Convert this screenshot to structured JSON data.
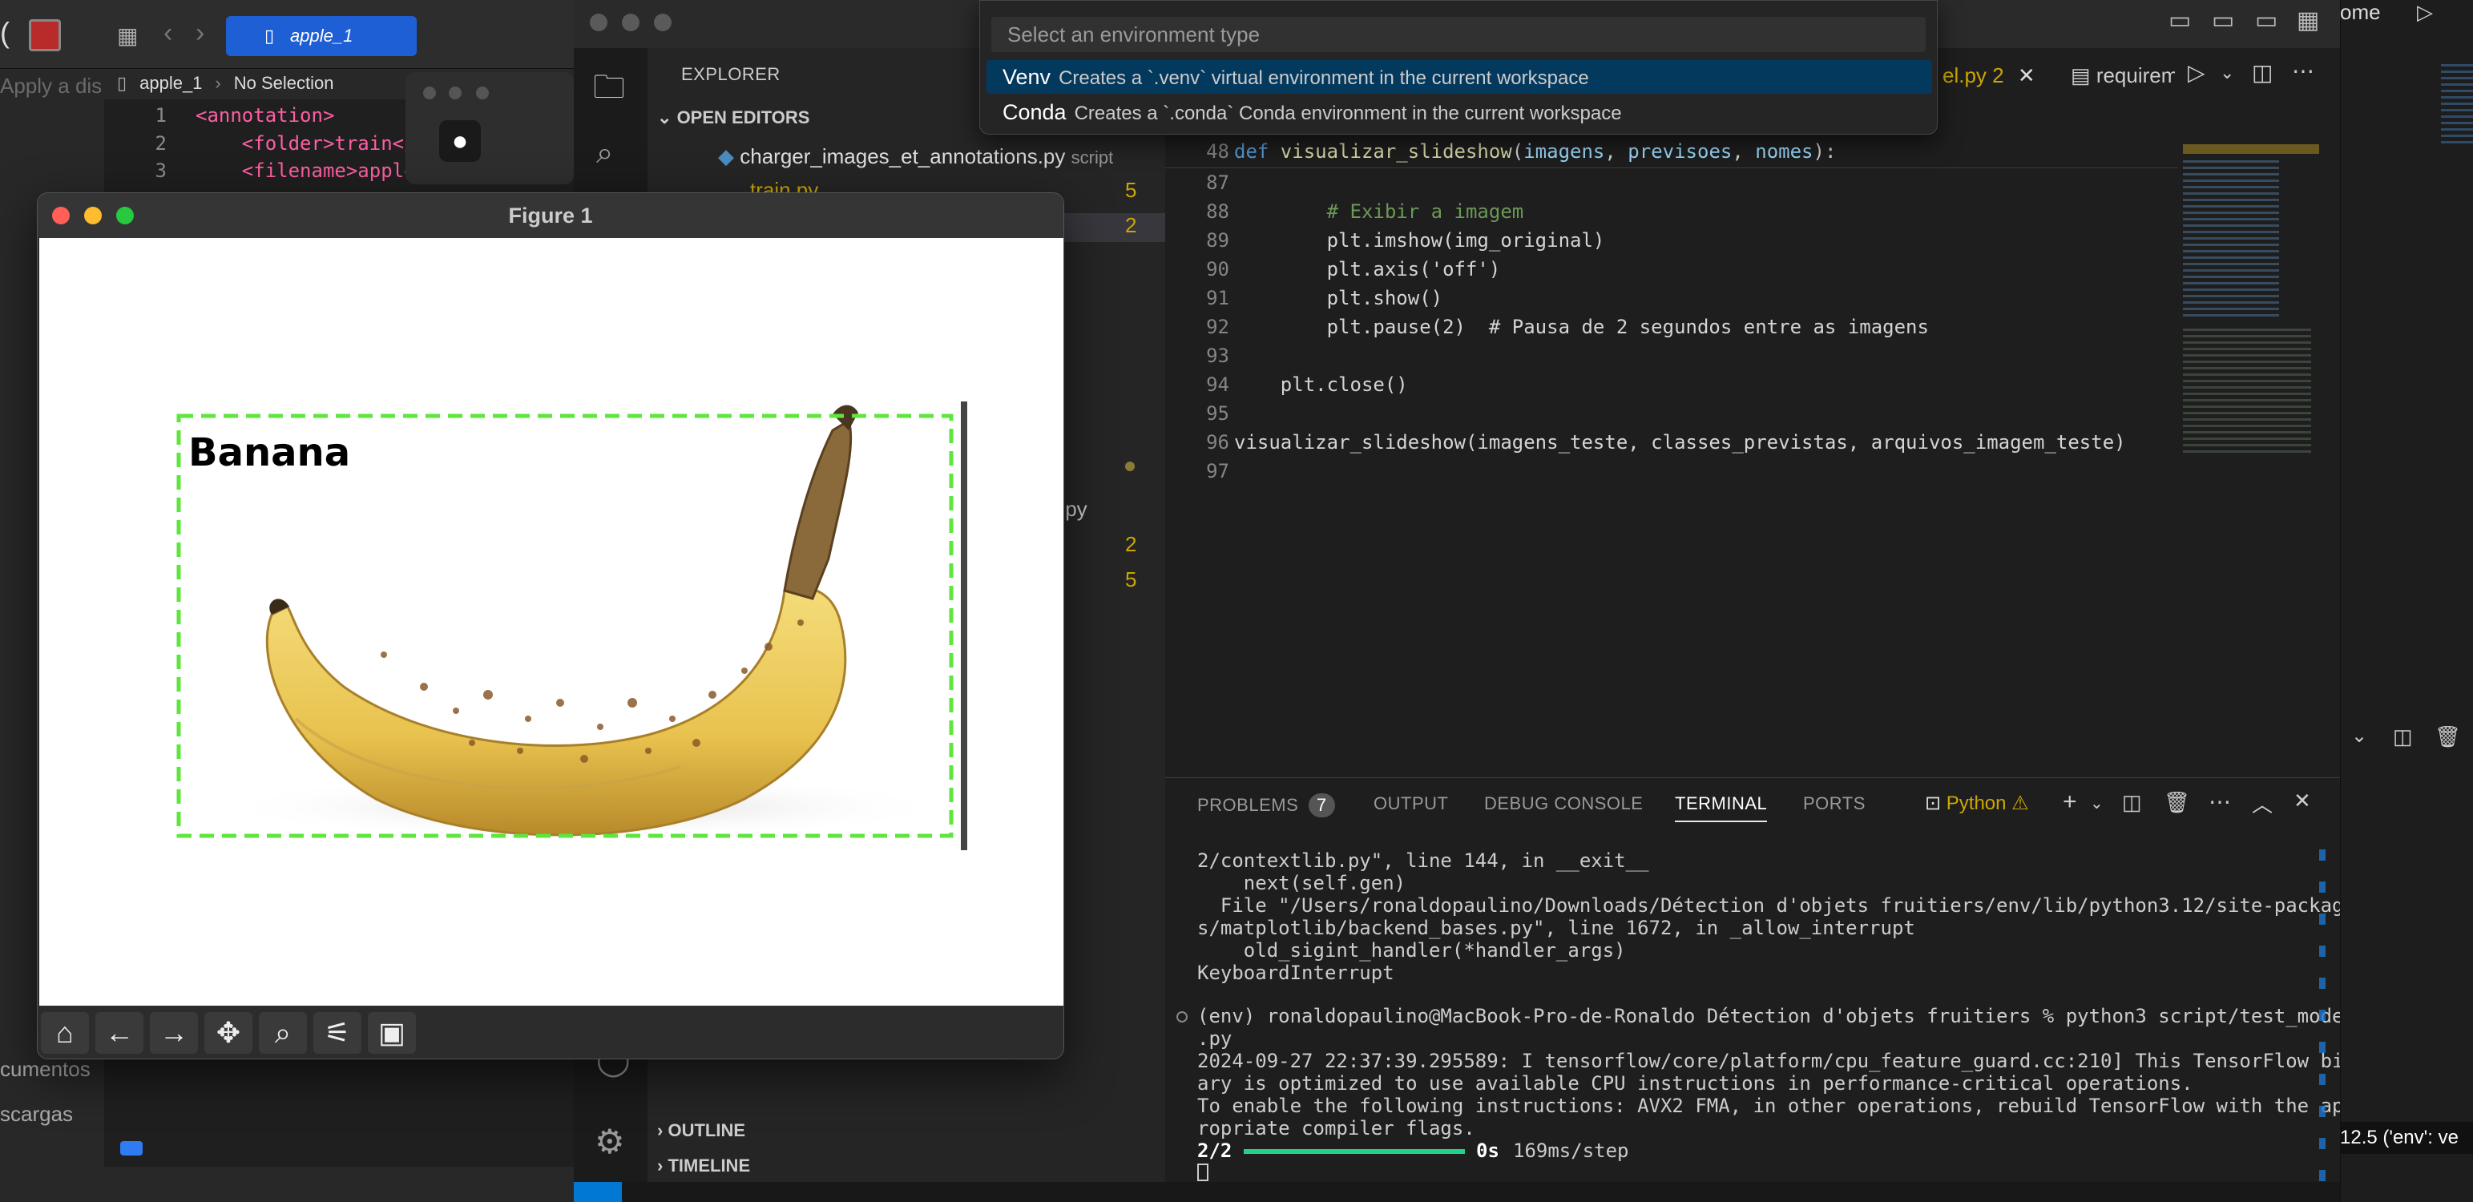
{
  "left_window": {
    "tab_title": "apple_1",
    "breadcrumb_file": "apple_1",
    "breadcrumb_selection": "No Selection",
    "apply_hint": "Apply a dis",
    "code_lines": [
      {
        "n": "1",
        "text": "<annotation>"
      },
      {
        "n": "2",
        "text": "    <folder>train</"
      },
      {
        "n": "3",
        "text": "    <filename>apple"
      }
    ],
    "sidebar_fragments": [
      "cumentos",
      "scargas"
    ]
  },
  "figure": {
    "title": "Figure 1",
    "label": "Banana",
    "box_color": "#5ee63c"
  },
  "vscode": {
    "explorer_title": "EXPLORER",
    "open_editors_label": "OPEN EDITORS",
    "open_editors": [
      {
        "name": "charger_images_et_annotations.py",
        "folder": "script"
      },
      {
        "name": "train.py",
        "folder": "script",
        "count": "5"
      },
      {
        "name": "",
        "folder": "",
        "count": "2"
      }
    ],
    "explorer_fragments": [
      ".py"
    ],
    "explorer_counts": [
      "2",
      "5"
    ],
    "outline_label": "OUTLINE",
    "timeline_label": "TIMELINE",
    "tabs": [
      {
        "label": "el.py 2",
        "active": true
      },
      {
        "label": "requirem",
        "active": false
      }
    ],
    "sticky_line": {
      "n": "48",
      "text": "def visualizar_slideshow(imagens, previsoes, nomes):"
    },
    "code": [
      {
        "n": "87",
        "text": ""
      },
      {
        "n": "88",
        "text": "        # Exibir a imagem"
      },
      {
        "n": "89",
        "text": "        plt.imshow(img_original)"
      },
      {
        "n": "90",
        "text": "        plt.axis('off')"
      },
      {
        "n": "91",
        "text": "        plt.show()"
      },
      {
        "n": "92",
        "text": "        plt.pause(2)  # Pausa de 2 segundos entre as imagens"
      },
      {
        "n": "93",
        "text": ""
      },
      {
        "n": "94",
        "text": "    plt.close()"
      },
      {
        "n": "95",
        "text": ""
      },
      {
        "n": "96",
        "text": "visualizar_slideshow(imagens_teste, classes_previstas, arquivos_imagem_teste)"
      },
      {
        "n": "97",
        "text": ""
      }
    ],
    "panel_tabs": {
      "problems": "PROBLEMS",
      "problems_count": "7",
      "output": "OUTPUT",
      "debug": "DEBUG CONSOLE",
      "terminal": "TERMINAL",
      "ports": "PORTS",
      "shell": "Python"
    },
    "terminal_lines": [
      "2/contextlib.py\", line 144, in __exit__",
      "    next(self.gen)",
      "  File \"/Users/ronaldopaulino/Downloads/Détection d'objets fruitiers/env/lib/python3.12/site-package",
      "s/matplotlib/backend_bases.py\", line 1672, in _allow_interrupt",
      "    old_sigint_handler(*handler_args)",
      "KeyboardInterrupt",
      "",
      "(env) ronaldopaulino@MacBook-Pro-de-Ronaldo Détection d'objets fruitiers % python3 script/test_model",
      ".py",
      "2024-09-27 22:37:39.295589: I tensorflow/core/platform/cpu_feature_guard.cc:210] This TensorFlow bin",
      "ary is optimized to use available CPU instructions in performance-critical operations.",
      "To enable the following instructions: AVX2 FMA, in other operations, rebuild TensorFlow with the app",
      "ropriate compiler flags."
    ],
    "progress_text": "2/2",
    "progress_fraction": 1.0,
    "progress_time": "0s",
    "progress_rate": "169ms/step"
  },
  "quickpick": {
    "placeholder": "Select an environment type",
    "items": [
      {
        "name": "Venv",
        "desc": "Creates a `.venv` virtual environment in the current workspace"
      },
      {
        "name": "Conda",
        "desc": "Creates a `.conda` Conda environment in the current workspace"
      }
    ]
  },
  "right_strip": {
    "title_fragment": "ome",
    "interpreter": "12.5 ('env': ve"
  },
  "colors": {
    "accent": "#0078d4",
    "keyword": "#569cd6",
    "function": "#dcdcaa",
    "comment": "#6a9955",
    "string": "#ce9178",
    "progress": "#23d18b"
  }
}
